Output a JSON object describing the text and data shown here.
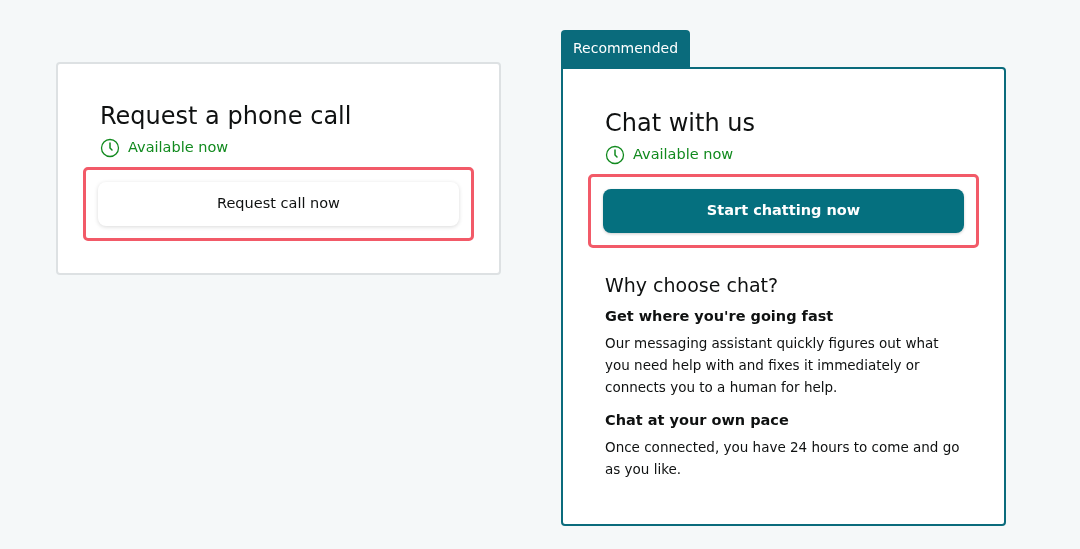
{
  "options": [
    {
      "title": "Request a phone call",
      "availability": "Available now",
      "recommended": false,
      "action": {
        "label": "Request call now",
        "kind": "secondary",
        "highlighted": true
      }
    },
    {
      "badge": "Recommended",
      "title": "Chat with us",
      "availability": "Available now",
      "recommended": true,
      "action": {
        "label": "Start chatting now",
        "kind": "primary",
        "highlighted": true
      },
      "reasons_heading": "Why choose chat?",
      "reasons": [
        {
          "title": "Get where you're going fast",
          "text": "Our messaging assistant quickly figures out what you need help with and fixes it immediately or connects you to a human for help."
        },
        {
          "title": "Chat at your own pace",
          "text": "Once connected, you have 24 hours to come and go as you like."
        }
      ]
    }
  ]
}
